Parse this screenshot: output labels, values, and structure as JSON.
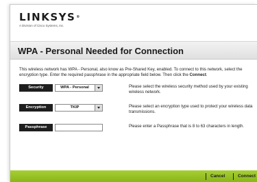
{
  "logo": {
    "brand": "LINKSYS",
    "trademark": "®",
    "subtitle": "A Division of Cisco Systems, Inc."
  },
  "page_title": "WPA - Personal Needed for Connection",
  "intro": {
    "text": "This wireless network has WPA - Personal, also know as Pre-Shared Key, enabled. To connect to this network, select the encryption type. Enter the required passphrase in the appropriate field below. Then click the ",
    "connect_word": "Connect",
    "end": "."
  },
  "security": {
    "label": "Security",
    "value": "WPA - Personal",
    "help": "Please select the wireless security method used by your existing wireless network."
  },
  "encryption": {
    "label": "Encryption",
    "value": "TKIP",
    "help": "Please select an encryption type used to protect your wireless data transmissions."
  },
  "passphrase": {
    "label": "Passphrase",
    "value": "",
    "help": "Please enter a Passphrase that is 8 to 63 characters in length."
  },
  "footer": {
    "cancel_label": "Cancel",
    "connect_label": "Connect"
  },
  "colors": {
    "footer_green": "#9cc62a",
    "label_black": "#1e1e1e"
  }
}
